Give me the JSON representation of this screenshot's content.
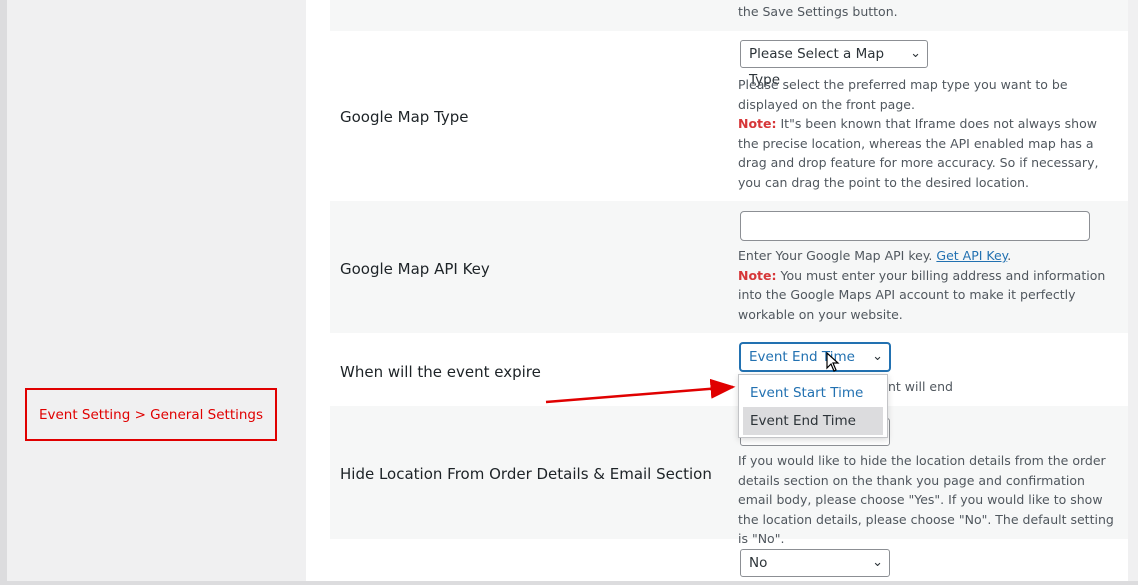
{
  "callout": {
    "text": "Event Setting > General Settings"
  },
  "rows": {
    "top_desc": "the Save Settings button.",
    "map_type": {
      "label": "Google Map Type",
      "select_value": "Please Select a Map Type",
      "desc": "Please select the preferred map type you want to be displayed on the front page.",
      "note_label": "Note:",
      "note_text": " It\"s been known that Iframe does not always show the precise location, whereas the API enabled map has a drag and drop feature for more accuracy. So if necessary, you can drag the point to the desired location."
    },
    "api_key": {
      "label": "Google Map API Key",
      "input_value": "",
      "desc": "Enter Your Google Map API key. ",
      "link_text": "Get API Key",
      "desc_after_link": ".",
      "note_label": "Note:",
      "note_text": " You must enter your billing address and information into the Google Maps API account to make it perfectly workable on your website."
    },
    "expire": {
      "label": "When will the event expire",
      "select_value": "Event End Time",
      "desc_partial": "nt will end",
      "options": [
        "Event Start Time",
        "Event End Time"
      ]
    },
    "hide_location": {
      "label": "Hide Location From Order Details & Email Section",
      "desc": "If you would like to hide the location details from the order details section on the thank you page and confirmation email body, please choose \"Yes\". If you would like to show the location details, please choose \"No\". The default setting is \"No\"."
    },
    "last": {
      "select_value": "No"
    }
  },
  "colors": {
    "accent": "#2271b1",
    "note": "#d63638",
    "callout": "#e00000"
  },
  "icons": {
    "chevron": "chevron-down-icon",
    "cursor": "mouse-pointer-icon"
  }
}
